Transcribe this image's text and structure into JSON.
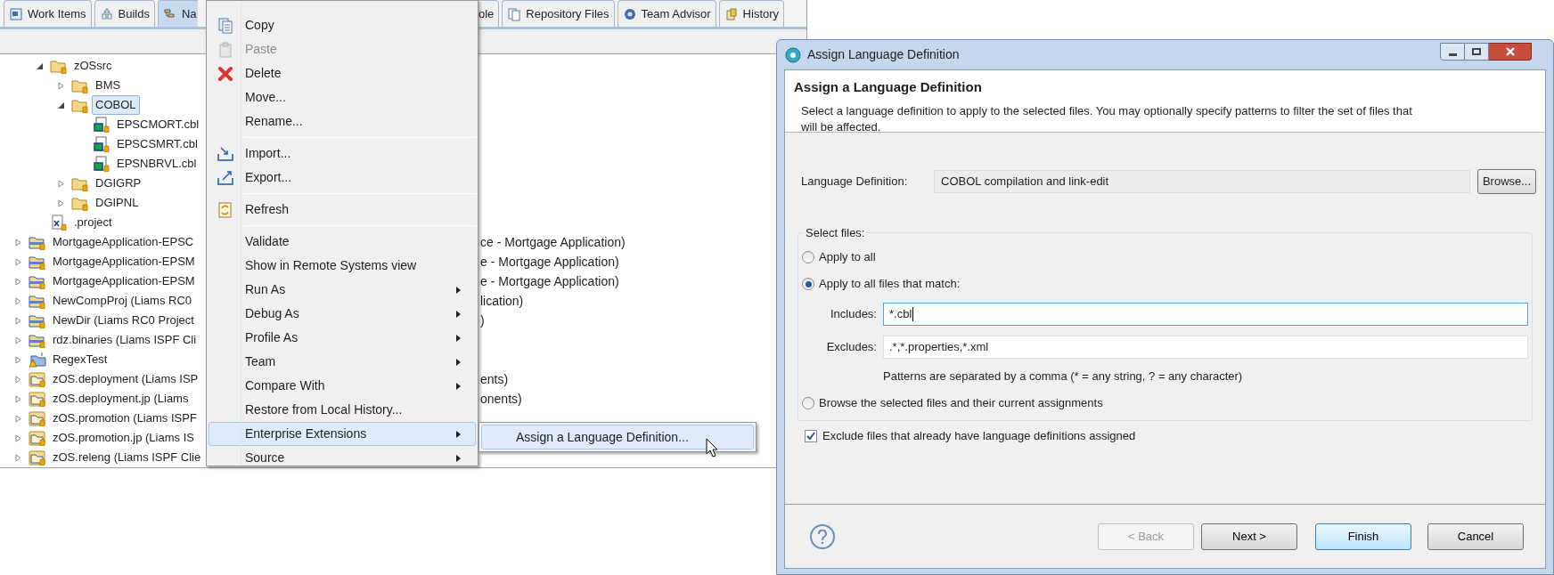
{
  "view_tabs": [
    {
      "label": "Work Items",
      "selected": false
    },
    {
      "label": "Builds",
      "selected": false
    },
    {
      "label": "Na",
      "selected": true
    },
    {
      "label": "ole",
      "selected": false
    },
    {
      "label": "Repository Files",
      "selected": false
    },
    {
      "label": "Team Advisor",
      "selected": false
    },
    {
      "label": "History",
      "selected": false
    }
  ],
  "tree": [
    {
      "children": [
        {
          "label": "zOSsrc",
          "kind": "folder",
          "expanded": true,
          "selected": false,
          "children": [
            {
              "label": "BMS",
              "kind": "folder",
              "expanded": false,
              "selected": false
            },
            {
              "label": "COBOL",
              "kind": "folder",
              "expanded": true,
              "selected": true,
              "children": [
                {
                  "label": "EPSCMORT.cbl",
                  "kind": "cobol_file",
                  "selected": false
                },
                {
                  "label": "EPSCSMRT.cbl",
                  "kind": "cobol_file",
                  "selected": false
                },
                {
                  "label": "EPSNBRVL.cbl",
                  "kind": "cobol_file",
                  "selected": false
                }
              ]
            },
            {
              "label": "DGIGRP",
              "kind": "folder",
              "expanded": false,
              "selected": false
            },
            {
              "label": "DGIPNL",
              "kind": "folder",
              "expanded": false,
              "selected": false
            }
          ]
        },
        {
          "label": ".project",
          "kind": "xml_file",
          "selected": false
        }
      ]
    },
    {
      "label": "MortgageApplication-EPSC",
      "tail": "ce - Mortgage Application)",
      "kind": "project",
      "expanded": false,
      "selected": false
    },
    {
      "label": "MortgageApplication-EPSM",
      "tail": "e - Mortgage Application)",
      "kind": "project",
      "expanded": false,
      "selected": false
    },
    {
      "label": "MortgageApplication-EPSM",
      "tail": "e - Mortgage Application)",
      "kind": "project",
      "expanded": false,
      "selected": false
    },
    {
      "label": "NewCompProj (Liams RC0",
      "tail": "lication)",
      "kind": "project",
      "expanded": false,
      "selected": false
    },
    {
      "label": "NewDir (Liams RC0 Project",
      "tail": ")",
      "kind": "project",
      "expanded": false,
      "selected": false
    },
    {
      "label": "rdz.binaries (Liams ISPF Cli",
      "kind": "project",
      "expanded": false,
      "selected": false
    },
    {
      "label": "RegexTest",
      "kind": "java_project",
      "expanded": false,
      "selected": false
    },
    {
      "label": "zOS.deployment (Liams ISP",
      "tail": "ents)",
      "kind": "zproject",
      "expanded": false,
      "selected": false
    },
    {
      "label": "zOS.deployment.jp (Liams",
      "tail": "onents)",
      "kind": "zproject",
      "expanded": false,
      "selected": false
    },
    {
      "label": "zOS.promotion (Liams ISPF",
      "kind": "zproject",
      "expanded": false,
      "selected": false
    },
    {
      "label": "zOS.promotion.jp (Liams IS",
      "kind": "zproject",
      "expanded": false,
      "selected": false
    },
    {
      "label": "zOS.releng (Liams ISPF Clie",
      "kind": "zproject",
      "expanded": false,
      "selected": false
    }
  ],
  "context_menu": [
    {
      "kind": "item",
      "label": "Copy",
      "disabled": false,
      "submenu": false,
      "selected": false
    },
    {
      "kind": "item",
      "label": "Paste",
      "disabled": true,
      "submenu": false,
      "selected": false
    },
    {
      "kind": "item",
      "label": "Delete",
      "disabled": false,
      "submenu": false,
      "selected": false
    },
    {
      "kind": "item",
      "label": "Move...",
      "disabled": false,
      "submenu": false,
      "selected": false
    },
    {
      "kind": "item",
      "label": "Rename...",
      "disabled": false,
      "submenu": false,
      "selected": false
    },
    {
      "kind": "separator"
    },
    {
      "kind": "item",
      "label": "Import...",
      "disabled": false,
      "submenu": false,
      "selected": false
    },
    {
      "kind": "item",
      "label": "Export...",
      "disabled": false,
      "submenu": false,
      "selected": false
    },
    {
      "kind": "separator"
    },
    {
      "kind": "item",
      "label": "Refresh",
      "disabled": false,
      "submenu": false,
      "selected": false
    },
    {
      "kind": "separator"
    },
    {
      "kind": "item",
      "label": "Validate",
      "disabled": false,
      "submenu": false,
      "selected": false
    },
    {
      "kind": "item",
      "label": "Show in Remote Systems view",
      "disabled": false,
      "submenu": false,
      "selected": false
    },
    {
      "kind": "item",
      "label": "Run As",
      "disabled": false,
      "submenu": true,
      "selected": false
    },
    {
      "kind": "item",
      "label": "Debug As",
      "disabled": false,
      "submenu": true,
      "selected": false
    },
    {
      "kind": "item",
      "label": "Profile As",
      "disabled": false,
      "submenu": true,
      "selected": false
    },
    {
      "kind": "item",
      "label": "Team",
      "disabled": false,
      "submenu": true,
      "selected": false
    },
    {
      "kind": "item",
      "label": "Compare With",
      "disabled": false,
      "submenu": true,
      "selected": false
    },
    {
      "kind": "item",
      "label": "Restore from Local History...",
      "disabled": false,
      "submenu": false,
      "selected": false
    },
    {
      "kind": "item",
      "label": "Enterprise Extensions",
      "disabled": false,
      "submenu": true,
      "selected": true
    },
    {
      "kind": "item",
      "label": "Source",
      "disabled": false,
      "submenu": true,
      "selected": false
    }
  ],
  "submenu": [
    {
      "label": "Assign a Language Definition...",
      "selected": true
    }
  ],
  "dialog": {
    "title": "Assign Language Definition",
    "heading": "Assign a Language Definition",
    "description": "Select a language definition to apply to the selected files. You may optionally specify patterns to filter the set of files that will be affected.",
    "language_definition": {
      "label": "Language Definition:",
      "value": "COBOL compilation and link-edit"
    },
    "browse_button": "Browse...",
    "group": {
      "label": "Select files:",
      "options": [
        {
          "label": "Apply to all",
          "selected": false
        },
        {
          "label": "Apply to all files that match:",
          "selected": true
        },
        {
          "label": "Browse the selected files and their current assignments",
          "selected": false
        }
      ],
      "includes": {
        "label": "Includes:",
        "value": "*.cbl",
        "focused": true
      },
      "excludes": {
        "label": "Excludes:",
        "value": ".*,*.properties,*.xml",
        "focused": false
      },
      "hint": "Patterns are separated by a comma (* = any string, ? = any character)"
    },
    "exclude_checkbox": {
      "label": "Exclude files that already have language definitions assigned",
      "checked": true
    },
    "buttons": [
      {
        "label": "< Back",
        "disabled": true,
        "default": false
      },
      {
        "label": "Next >",
        "disabled": false,
        "default": false
      },
      {
        "label": "Finish",
        "disabled": false,
        "default": true
      },
      {
        "label": "Cancel",
        "disabled": false,
        "default": false
      }
    ]
  }
}
